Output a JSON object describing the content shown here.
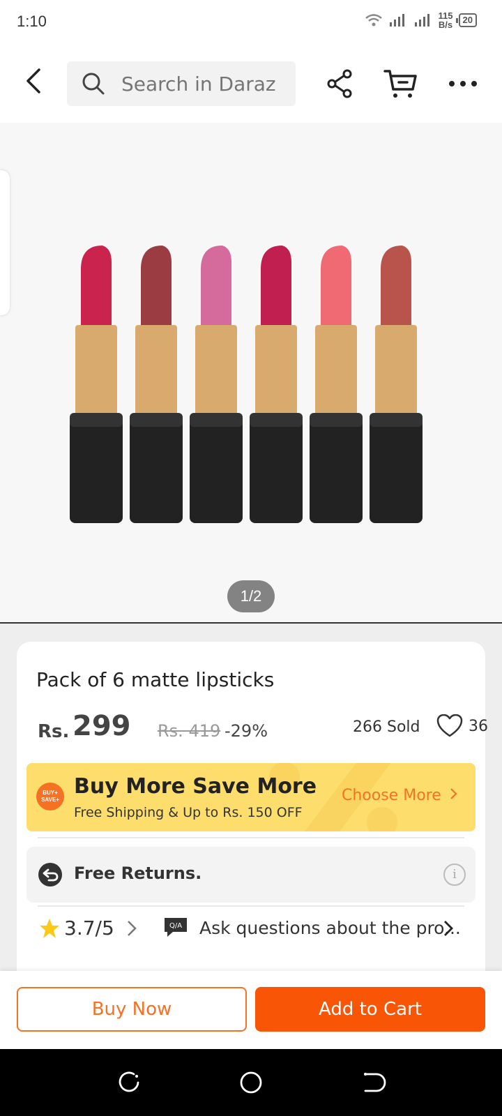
{
  "status_bar": {
    "time": "1:10",
    "net_speed_value": "115",
    "net_speed_unit": "B/s",
    "battery": "20"
  },
  "header": {
    "search_placeholder": "Search in Daraz",
    "icons": [
      "back-arrow-icon",
      "search-icon",
      "share-icon",
      "cart-icon",
      "more-icon"
    ]
  },
  "gallery": {
    "counter": "1/2",
    "lipstick_colors": [
      "#c9234e",
      "#9b3b42",
      "#d56a9c",
      "#c01f4f",
      "#f06a73",
      "#b8544c"
    ]
  },
  "product": {
    "title": "Pack of 6 matte lipsticks",
    "currency": "Rs.",
    "price": "299",
    "old_price": "Rs. 419",
    "discount": "-29%",
    "sold": "266 Sold",
    "wishlist_count": "36"
  },
  "promo": {
    "badge_line1": "BUY+",
    "badge_line2": "SAVE+",
    "title": "Buy More Save More",
    "subtitle": "Free Shipping & Up to Rs. 150 OFF",
    "link": "Choose More"
  },
  "returns": {
    "label": "Free Returns.",
    "info": "i"
  },
  "rating": {
    "value": "3.7/5",
    "qa_badge": "Q/A",
    "qa_text": "Ask questions about the pro..."
  },
  "actions": {
    "buy_now": "Buy Now",
    "add_to_cart": "Add to Cart"
  },
  "colors": {
    "accent": "#f57224",
    "cta": "#f85606",
    "promo_bg": "#fdde6d"
  }
}
